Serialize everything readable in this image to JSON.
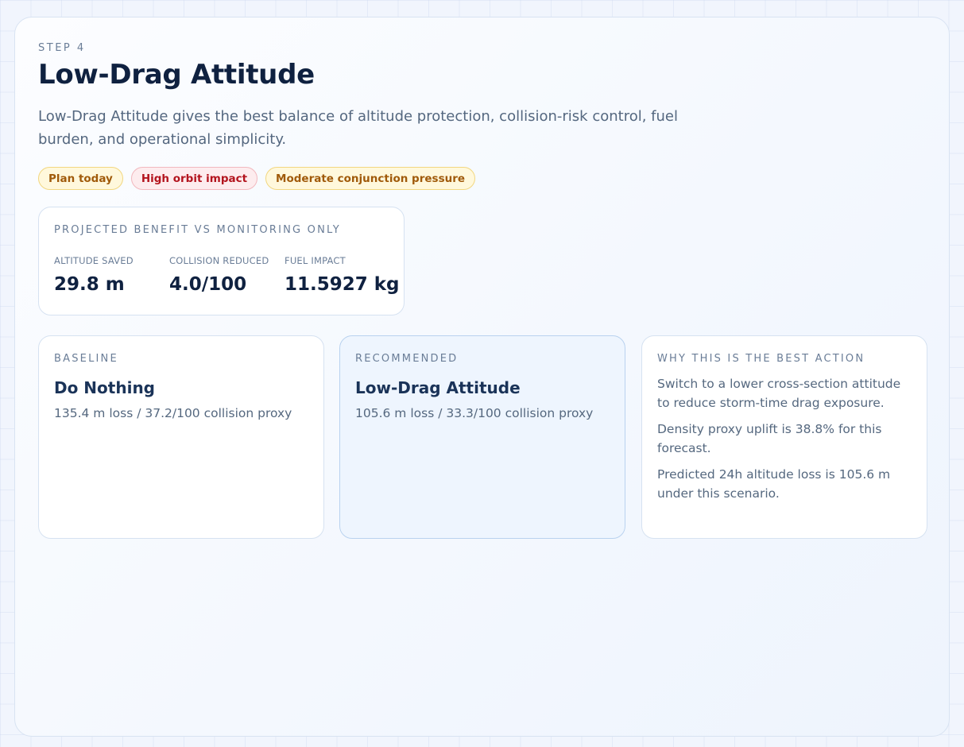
{
  "step": {
    "label": "STEP 4"
  },
  "title": "Low-Drag Attitude",
  "description": "Low-Drag Attitude gives the best balance of altitude protection, collision-risk control, fuel burden, and operational simplicity.",
  "badges": [
    {
      "label": "Plan today",
      "tone": "warn"
    },
    {
      "label": "High orbit impact",
      "tone": "danger"
    },
    {
      "label": "Moderate conjunction pressure",
      "tone": "warn"
    }
  ],
  "benefit": {
    "title": "PROJECTED BENEFIT VS MONITORING ONLY",
    "metrics": [
      {
        "label": "ALTITUDE SAVED",
        "value": "29.8 m"
      },
      {
        "label": "COLLISION REDUCED",
        "value": "4.0/100"
      },
      {
        "label": "FUEL IMPACT",
        "value": "11.5927 kg"
      }
    ]
  },
  "baseline": {
    "eyebrow": "BASELINE",
    "title": "Do Nothing",
    "summary": "135.4 m loss / 37.2/100 collision proxy"
  },
  "recommended": {
    "eyebrow": "RECOMMENDED",
    "title": "Low-Drag Attitude",
    "summary": "105.6 m loss / 33.3/100 collision proxy"
  },
  "why": {
    "eyebrow": "WHY THIS IS THE BEST ACTION",
    "points": [
      "Switch to a lower cross-section attitude to reduce storm-time drag exposure.",
      "Density proxy uplift is 38.8% for this forecast.",
      "Predicted 24h altitude loss is 105.6 m under this scenario."
    ]
  },
  "colors": {
    "warn_text": "#a05a0a",
    "warn_bg": "#fff8dc",
    "danger_text": "#b3141e",
    "danger_bg": "#fdecee",
    "recommended_bg": "#eef5fe"
  }
}
